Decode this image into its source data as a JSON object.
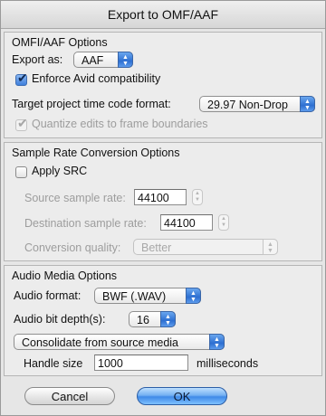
{
  "dialog": {
    "title": "Export to OMF/AAF"
  },
  "omf_section": {
    "title": "OMFI/AAF Options",
    "export_as_label": "Export as:",
    "export_as_value": "AAF",
    "enforce_avid_label": "Enforce Avid compatibility",
    "enforce_avid_checked": true,
    "target_tc_label": "Target project time code format:",
    "target_tc_value": "29.97 Non-Drop",
    "quantize_label": "Quantize edits to frame boundaries",
    "quantize_checked": true
  },
  "src_section": {
    "title": "Sample Rate Conversion Options",
    "apply_src_label": "Apply SRC",
    "apply_src_checked": false,
    "source_rate_label": "Source sample rate:",
    "source_rate_value": "44100",
    "dest_rate_label": "Destination sample rate:",
    "dest_rate_value": "44100",
    "quality_label": "Conversion quality:",
    "quality_value": "Better"
  },
  "audio_section": {
    "title": "Audio Media Options",
    "format_label": "Audio format:",
    "format_value": "BWF (.WAV)",
    "bitdepth_label": "Audio bit depth(s):",
    "bitdepth_value": "16",
    "consolidate_value": "Consolidate from source media",
    "handle_label": "Handle size",
    "handle_value": "1000",
    "handle_units": "milliseconds"
  },
  "buttons": {
    "cancel": "Cancel",
    "ok": "OK"
  },
  "colors": {
    "accent": "#3f8ae8",
    "panel": "#ececec"
  }
}
